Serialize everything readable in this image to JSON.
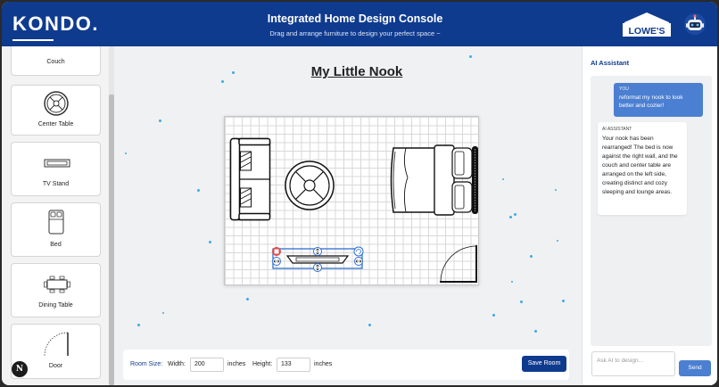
{
  "header": {
    "logo": "KONDO.",
    "title": "Integrated Home Design Console",
    "subtitle": "Drag and arrange furniture to design your perfect space ~",
    "partner_logo_text": "LOWE'S",
    "brand_color": "#0f3b8f"
  },
  "sidebar": {
    "items": [
      {
        "label": "Couch",
        "icon": "couch-icon"
      },
      {
        "label": "Center Table",
        "icon": "center-table-icon"
      },
      {
        "label": "TV Stand",
        "icon": "tv-stand-icon"
      },
      {
        "label": "Bed",
        "icon": "bed-icon"
      },
      {
        "label": "Dining Table",
        "icon": "dining-table-icon"
      },
      {
        "label": "Door",
        "icon": "door-icon"
      }
    ],
    "badge": "N"
  },
  "canvas": {
    "room_title": "My Little Nook",
    "toolbar": {
      "room_size_label": "Room Size:",
      "width_label": "Width:",
      "width_value": "200",
      "width_unit": "inches",
      "height_label": "Height:",
      "height_value": "133",
      "height_unit": "inches",
      "save_label": "Save Room"
    }
  },
  "chat": {
    "title": "AI Assistant",
    "messages": [
      {
        "sender": "YOU",
        "text": "reformat my nook to look better and cozier!"
      },
      {
        "sender": "AI ASSISTANT",
        "text": "Your nook has been rearranged! The bed is now against the right wall, and the couch and center table are arranged on the left side, creating distinct and cozy sleeping and lounge areas."
      }
    ],
    "input_placeholder": "Ask AI to design...",
    "send_label": "Send",
    "accent_color": "#4b7fd1"
  }
}
